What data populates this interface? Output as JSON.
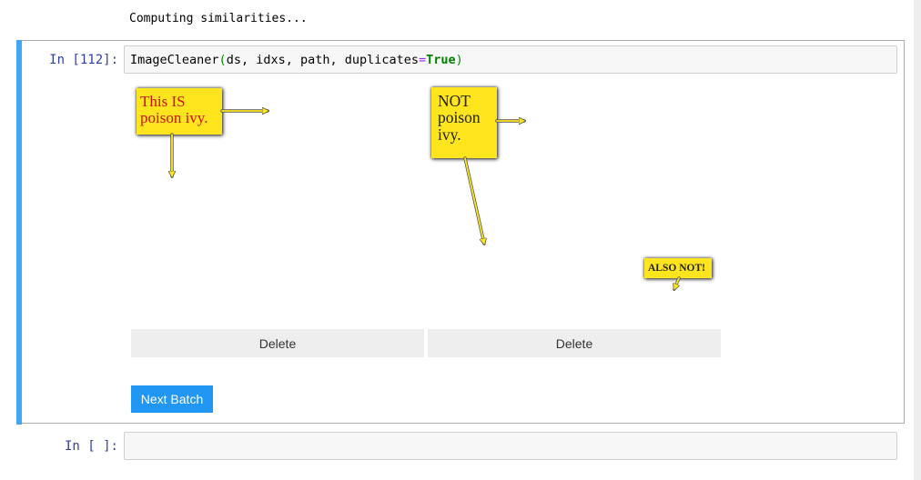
{
  "output": {
    "text": "Computing similarities..."
  },
  "cell_112": {
    "prompt": "In [112]:",
    "code": {
      "func": "ImageCleaner",
      "open_paren": "(",
      "args": "ds, idxs, path, duplicates",
      "equals": "=",
      "kw": "True",
      "close_paren": ")"
    }
  },
  "images": [
    {
      "lines": [
        "This IS",
        "poison ivy."
      ]
    },
    {
      "lines": [
        "NOT",
        "poison",
        "ivy."
      ]
    },
    {
      "lines": [
        "ALSO NOT!"
      ]
    }
  ],
  "buttons": {
    "delete_1": "Delete",
    "delete_2": "Delete",
    "next_batch": "Next Batch"
  },
  "cell_empty": {
    "prompt": "In [ ]:"
  },
  "colors": {
    "cell_bar": "#42a5f5",
    "prompt": "#303f9f",
    "next_batch_bg": "#2196f3",
    "sign_yellow": "#ffe51e"
  },
  "icons": [
    "arrow-right-icon",
    "arrow-down-icon"
  ]
}
